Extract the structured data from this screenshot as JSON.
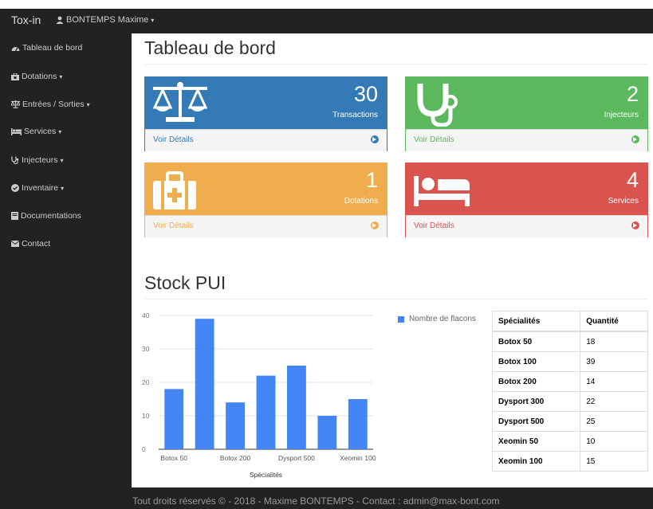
{
  "navbar": {
    "brand": "Tox-in",
    "user": "BONTEMPS Maxime"
  },
  "sidebar": {
    "items": [
      {
        "label": "Tableau de bord",
        "icon": "dashboard-icon",
        "dropdown": false
      },
      {
        "label": "Dotations",
        "icon": "briefcase-icon",
        "dropdown": true
      },
      {
        "label": "Entrées / Sorties",
        "icon": "balance-icon",
        "dropdown": true
      },
      {
        "label": "Services",
        "icon": "bed-icon",
        "dropdown": true
      },
      {
        "label": "Injecteurs",
        "icon": "stethoscope-icon",
        "dropdown": true
      },
      {
        "label": "Inventaire",
        "icon": "check-circle-icon",
        "dropdown": true
      },
      {
        "label": "Documentations",
        "icon": "book-icon",
        "dropdown": false
      },
      {
        "label": "Contact",
        "icon": "envelope-icon",
        "dropdown": false
      }
    ]
  },
  "page": {
    "title": "Tableau de bord",
    "stock_title": "Stock PUI"
  },
  "panels": [
    {
      "count": "30",
      "label": "Transactions",
      "link": "Voir Détails",
      "color": "#337ab7",
      "icon": "balance-icon"
    },
    {
      "count": "2",
      "label": "Injecteurs",
      "link": "Voir Détails",
      "color": "#5cb85c",
      "icon": "stethoscope-icon"
    },
    {
      "count": "1",
      "label": "Dotations",
      "link": "Voir Détails",
      "color": "#f0ad4e",
      "icon": "medkit-icon"
    },
    {
      "count": "4",
      "label": "Services",
      "link": "Voir Détails",
      "color": "#d9534f",
      "icon": "bed-icon"
    }
  ],
  "chart_data": {
    "type": "bar",
    "categories": [
      "Botox 50",
      "Botox 100",
      "Botox 200",
      "Dysport 300",
      "Dysport 500",
      "Xeomin 50",
      "Xeomin 100"
    ],
    "visible_tick_labels": [
      "Botox 50",
      "Botox 200",
      "Dysport 500",
      "Xeomin 100"
    ],
    "series": [
      {
        "name": "Nombre de flacons",
        "values": [
          18,
          39,
          14,
          22,
          25,
          10,
          15
        ]
      }
    ],
    "xlabel": "Spécialités",
    "ylabel": "",
    "ylim": [
      0,
      40
    ],
    "yticks": [
      0,
      10,
      20,
      30,
      40
    ],
    "grid": true,
    "legend": "right",
    "color": "#4285f4"
  },
  "table": {
    "headers": [
      "Spécialités",
      "Quantité"
    ],
    "rows": [
      [
        "Botox 50",
        "18"
      ],
      [
        "Botox 100",
        "39"
      ],
      [
        "Botox 200",
        "14"
      ],
      [
        "Dysport 300",
        "22"
      ],
      [
        "Dysport 500",
        "25"
      ],
      [
        "Xeomin 50",
        "10"
      ],
      [
        "Xeomin 100",
        "15"
      ]
    ]
  },
  "footer": {
    "text": "Tout droits réservés © - 2018 - Maxime BONTEMPS - Contact : admin@max-bont.com"
  }
}
